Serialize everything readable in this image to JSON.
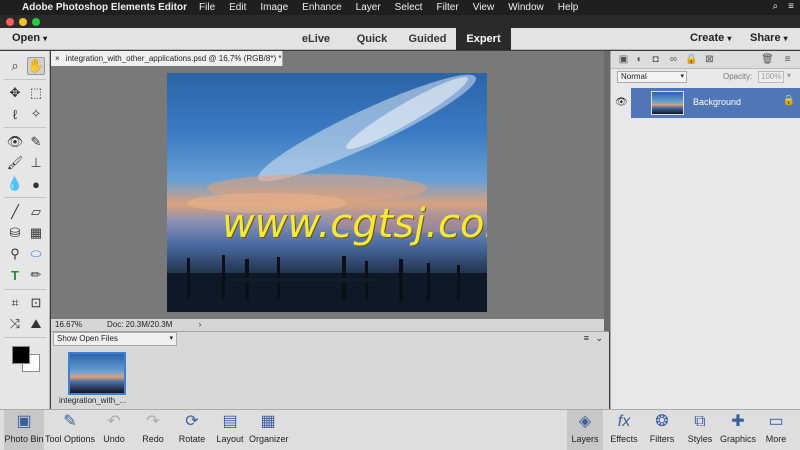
{
  "menubar": {
    "app_name": "Adobe Photoshop Elements Editor",
    "menus": [
      "File",
      "Edit",
      "Image",
      "Enhance",
      "Layer",
      "Select",
      "Filter",
      "View",
      "Window",
      "Help"
    ]
  },
  "modebar": {
    "open_label": "Open",
    "modes": [
      "eLive",
      "Quick",
      "Guided",
      "Expert"
    ],
    "active_mode": "Expert",
    "create_label": "Create",
    "share_label": "Share"
  },
  "document": {
    "tab_title": "integration_with_other_applications.psd @ 16.7% (RGB/8*) *",
    "close_glyph": "×",
    "zoom": "16.67%",
    "doc_size": "Doc: 20.3M/20.3M",
    "watermark": "www.cgtsj.com"
  },
  "photobin": {
    "selector_label": "Show Open Files",
    "thumbnail_caption": "integration_with_..."
  },
  "layers": {
    "blend_mode": "Normal",
    "opacity_label": "Opacity:",
    "opacity_value": "100%",
    "layer_name": "Background"
  },
  "bottombar": {
    "left": [
      {
        "label": "Photo Bin",
        "icon": "photo-bin-icon"
      },
      {
        "label": "Tool Options",
        "icon": "tool-options-icon"
      },
      {
        "label": "Undo",
        "icon": "undo-icon"
      },
      {
        "label": "Redo",
        "icon": "redo-icon"
      },
      {
        "label": "Rotate",
        "icon": "rotate-icon"
      },
      {
        "label": "Layout",
        "icon": "layout-icon"
      },
      {
        "label": "Organizer",
        "icon": "organizer-icon"
      }
    ],
    "right": [
      {
        "label": "Layers",
        "icon": "layers-icon"
      },
      {
        "label": "Effects",
        "icon": "effects-icon"
      },
      {
        "label": "Filters",
        "icon": "filters-icon"
      },
      {
        "label": "Styles",
        "icon": "styles-icon"
      },
      {
        "label": "Graphics",
        "icon": "graphics-icon"
      },
      {
        "label": "More",
        "icon": "more-icon"
      }
    ]
  },
  "colors": {
    "accent_blue": "#4f77b7",
    "watermark_yellow": "#f5e83a",
    "active_mode_bg": "#2b2b2b"
  }
}
